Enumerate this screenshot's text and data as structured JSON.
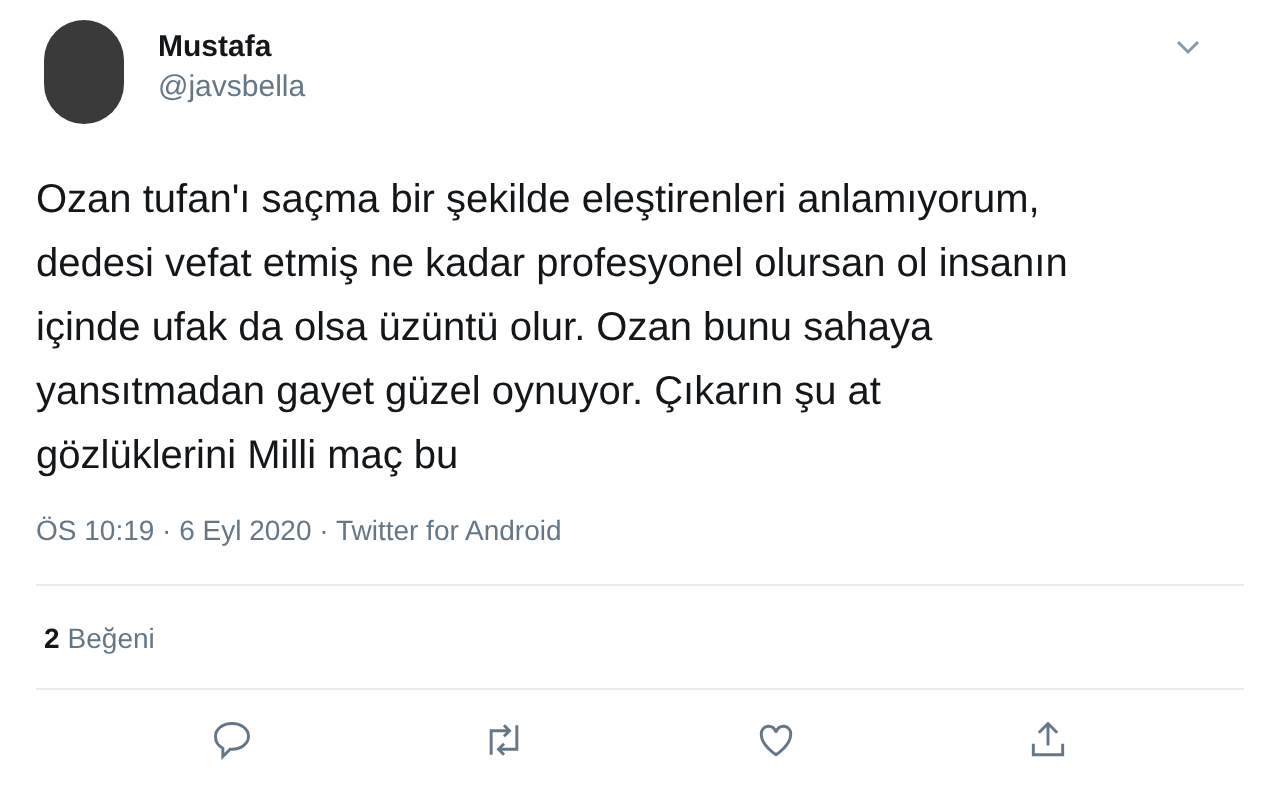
{
  "author": {
    "name": "Mustafa",
    "handle": "@javsbella"
  },
  "tweet": {
    "text": "Ozan tufan'ı saçma bir şekilde eleştirenleri anlamıyorum, dedesi vefat etmiş ne kadar profesyonel olursan ol insanın içinde ufak da olsa üzüntü olur. Ozan bunu sahaya yansıtmadan gayet güzel oynuyor. Çıkarın şu at gözlüklerini Milli maç bu",
    "meta": "ÖS 10:19 · 6 Eyl 2020 · Twitter for Android"
  },
  "likes": {
    "count": "2",
    "label": "Beğeni"
  },
  "actions": [
    {
      "kind": "reply"
    },
    {
      "kind": "retweet"
    },
    {
      "kind": "like"
    },
    {
      "kind": "share"
    }
  ]
}
